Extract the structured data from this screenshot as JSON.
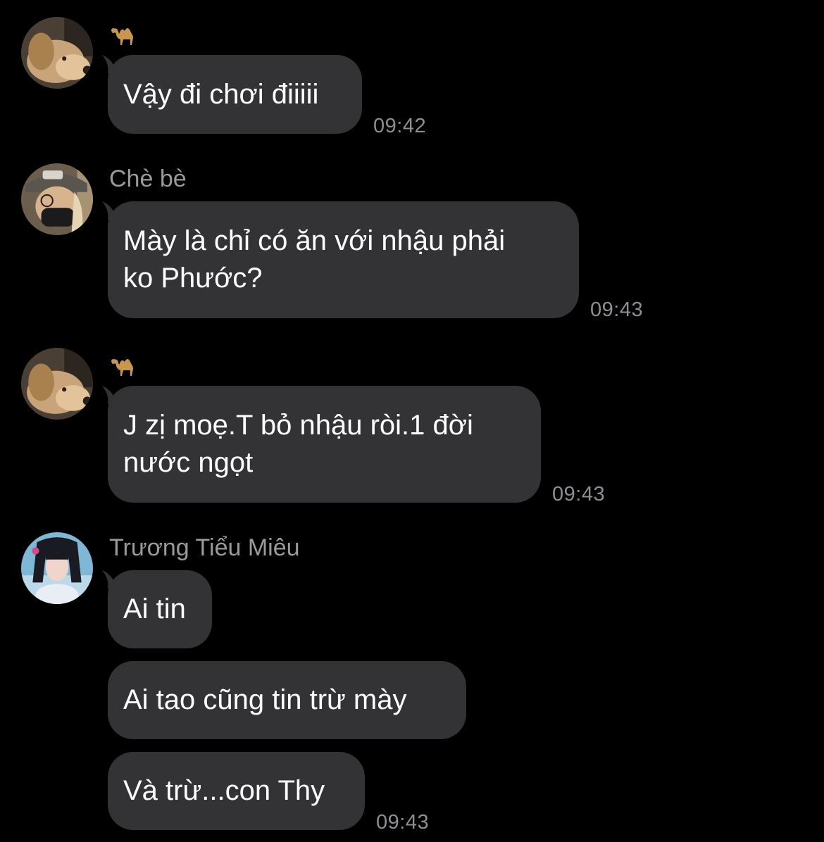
{
  "colors": {
    "background": "#000000",
    "bubble": "#333335",
    "sender_name": "#9a9a9a",
    "timestamp": "#8e8e93",
    "message_text": "#ffffff"
  },
  "messages": [
    {
      "sender_icon": "camel-emoji-icon",
      "avatar": "dog-avatar",
      "bubbles": [
        "Vậy đi chơi điiiii"
      ],
      "time": "09:42"
    },
    {
      "sender": "Chè bè",
      "avatar": "masked-person-avatar",
      "bubbles": [
        "Mày là chỉ có ăn với nhậu phải\nko Phước?"
      ],
      "time": "09:43"
    },
    {
      "sender_icon": "camel-emoji-icon",
      "avatar": "dog-avatar",
      "bubbles": [
        "J zị moẹ.T bỏ nhậu ròi.1 đời\nnước ngọt"
      ],
      "time": "09:43"
    },
    {
      "sender": "Trương Tiểu Miêu",
      "avatar": "girl-avatar",
      "bubbles": [
        "Ai tin",
        "Ai tao cũng tin trừ mày",
        "Và trừ...con Thy"
      ],
      "time": "09:43"
    }
  ]
}
